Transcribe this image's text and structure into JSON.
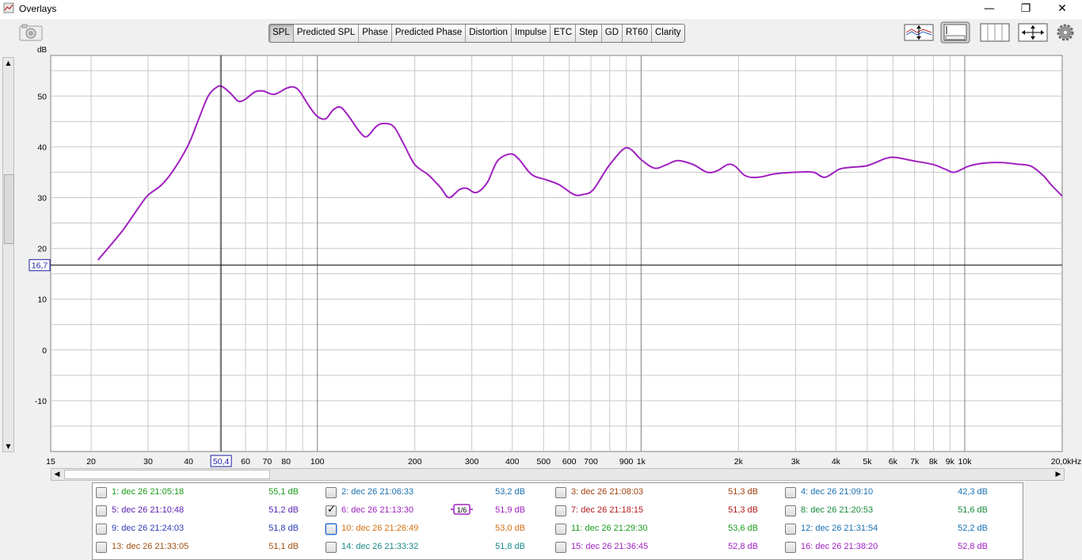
{
  "window": {
    "title": "Overlays",
    "controls": [
      "—",
      "❐",
      "✕"
    ]
  },
  "tabs": [
    {
      "label": "SPL",
      "active": true
    },
    {
      "label": "Predicted SPL",
      "active": false
    },
    {
      "label": "Phase",
      "active": false
    },
    {
      "label": "Predicted Phase",
      "active": false
    },
    {
      "label": "Distortion",
      "active": false
    },
    {
      "label": "Impulse",
      "active": false
    },
    {
      "label": "ETC",
      "active": false
    },
    {
      "label": "Step",
      "active": false
    },
    {
      "label": "GD",
      "active": false
    },
    {
      "label": "RT60",
      "active": false
    },
    {
      "label": "Clarity",
      "active": false
    }
  ],
  "colors": {
    "trace": "#a020c0",
    "cursor_box": "#1a1aa0",
    "grid": "#c8c8c8",
    "grid_major": "#808080"
  },
  "chart_data": {
    "type": "line",
    "ylabel": "dB",
    "xlim": [
      15,
      20000
    ],
    "ylim": [
      -20,
      58
    ],
    "x_scale": "log",
    "y_ticks": [
      -10,
      0,
      10,
      20,
      30,
      40,
      50
    ],
    "x_ticks": [
      {
        "v": 15,
        "label": "15"
      },
      {
        "v": 20,
        "label": "20"
      },
      {
        "v": 30,
        "label": "30"
      },
      {
        "v": 40,
        "label": "40"
      },
      {
        "v": 60,
        "label": "60"
      },
      {
        "v": 70,
        "label": "70"
      },
      {
        "v": 80,
        "label": "80"
      },
      {
        "v": 100,
        "label": "100"
      },
      {
        "v": 200,
        "label": "200"
      },
      {
        "v": 300,
        "label": "300"
      },
      {
        "v": 400,
        "label": "400"
      },
      {
        "v": 500,
        "label": "500"
      },
      {
        "v": 600,
        "label": "600"
      },
      {
        "v": 700,
        "label": "700"
      },
      {
        "v": 900,
        "label": "900"
      },
      {
        "v": 1000,
        "label": "1k"
      },
      {
        "v": 2000,
        "label": "2k"
      },
      {
        "v": 3000,
        "label": "3k"
      },
      {
        "v": 4000,
        "label": "4k"
      },
      {
        "v": 5000,
        "label": "5k"
      },
      {
        "v": 6000,
        "label": "6k"
      },
      {
        "v": 7000,
        "label": "7k"
      },
      {
        "v": 8000,
        "label": "8k"
      },
      {
        "v": 9000,
        "label": "9k"
      },
      {
        "v": 10000,
        "label": "10k"
      },
      {
        "v": 20000,
        "label": "20,0kHz"
      }
    ],
    "cursor": {
      "x": 50.4,
      "x_label": "50,4",
      "y": 16.7,
      "y_label": "16,7"
    },
    "series": [
      {
        "color": "#a020c0",
        "points": [
          [
            21,
            17.7
          ],
          [
            25,
            23.5
          ],
          [
            28,
            28
          ],
          [
            30,
            30.5
          ],
          [
            33,
            32.5
          ],
          [
            36,
            35.5
          ],
          [
            40,
            40.5
          ],
          [
            43,
            45.5
          ],
          [
            46,
            50
          ],
          [
            49,
            51.8
          ],
          [
            51,
            51.8
          ],
          [
            54,
            50.5
          ],
          [
            57,
            49
          ],
          [
            60,
            49.4
          ],
          [
            64,
            50.8
          ],
          [
            68,
            51
          ],
          [
            72,
            50.4
          ],
          [
            75,
            50.5
          ],
          [
            80,
            51.5
          ],
          [
            84,
            51.8
          ],
          [
            88,
            51
          ],
          [
            95,
            47.7
          ],
          [
            100,
            46
          ],
          [
            106,
            45.5
          ],
          [
            112,
            47.3
          ],
          [
            118,
            47.8
          ],
          [
            125,
            46
          ],
          [
            135,
            43
          ],
          [
            142,
            42
          ],
          [
            152,
            44
          ],
          [
            160,
            44.6
          ],
          [
            172,
            44
          ],
          [
            185,
            40.5
          ],
          [
            200,
            36.5
          ],
          [
            220,
            34.5
          ],
          [
            240,
            32
          ],
          [
            255,
            30
          ],
          [
            275,
            31.6
          ],
          [
            290,
            31.8
          ],
          [
            310,
            31
          ],
          [
            335,
            33
          ],
          [
            360,
            37.2
          ],
          [
            395,
            38.6
          ],
          [
            420,
            37.5
          ],
          [
            460,
            34.5
          ],
          [
            510,
            33.5
          ],
          [
            560,
            32.5
          ],
          [
            620,
            30.6
          ],
          [
            660,
            30.6
          ],
          [
            710,
            31.5
          ],
          [
            790,
            36
          ],
          [
            880,
            39.5
          ],
          [
            930,
            39.5
          ],
          [
            1000,
            37.5
          ],
          [
            1100,
            35.8
          ],
          [
            1200,
            36.5
          ],
          [
            1300,
            37.3
          ],
          [
            1450,
            36.5
          ],
          [
            1600,
            35
          ],
          [
            1720,
            35.3
          ],
          [
            1850,
            36.5
          ],
          [
            1950,
            36.2
          ],
          [
            2100,
            34.3
          ],
          [
            2300,
            34
          ],
          [
            2600,
            34.7
          ],
          [
            3000,
            35
          ],
          [
            3400,
            35
          ],
          [
            3700,
            34
          ],
          [
            4100,
            35.6
          ],
          [
            4500,
            36
          ],
          [
            5000,
            36.3
          ],
          [
            5700,
            37.7
          ],
          [
            6100,
            37.9
          ],
          [
            7000,
            37.2
          ],
          [
            8000,
            36.5
          ],
          [
            8700,
            35.6
          ],
          [
            9300,
            35
          ],
          [
            10300,
            36.2
          ],
          [
            11500,
            36.8
          ],
          [
            13000,
            36.9
          ],
          [
            14500,
            36.6
          ],
          [
            16000,
            36.2
          ],
          [
            17500,
            34.3
          ],
          [
            18500,
            32.5
          ],
          [
            20000,
            30.3
          ]
        ]
      }
    ]
  },
  "measurements": [
    {
      "label": "1: dec 26 21:05:18",
      "value": "55,1 dB",
      "color": "#1a9a1a",
      "checked": false
    },
    {
      "label": "2: dec 26 21:06:33",
      "value": "53,2 dB",
      "color": "#1a70b0",
      "checked": false
    },
    {
      "label": "3: dec 26 21:08:03",
      "value": "51,3 dB",
      "color": "#a04010",
      "checked": false
    },
    {
      "label": "4: dec 26 21:09:10",
      "value": "42,3 dB",
      "color": "#1a70b0",
      "checked": false
    },
    {
      "label": "5: dec 26 21:10:48",
      "value": "51,2 dB",
      "color": "#5a20b0",
      "checked": false
    },
    {
      "label": "6: dec 26 21:13:30",
      "value": "51,9 dB",
      "color": "#a020c0",
      "checked": true
    },
    {
      "label": "7: dec 26 21:18:15",
      "value": "51,3 dB",
      "color": "#b01a1a",
      "checked": false
    },
    {
      "label": "8: dec 26 21:20:53",
      "value": "51,6 dB",
      "color": "#1a8a3a",
      "checked": false
    },
    {
      "label": "9: dec 26 21:24:03",
      "value": "51,8 dB",
      "color": "#2a3ab0",
      "checked": false
    },
    {
      "label": "10: dec 26 21:26:49",
      "value": "53,0 dB",
      "color": "#d07010",
      "checked": false,
      "focus": true
    },
    {
      "label": "11: dec 26 21:29:30",
      "value": "53,6 dB",
      "color": "#1a9a1a",
      "checked": false
    },
    {
      "label": "12: dec 26 21:31:54",
      "value": "52,2 dB",
      "color": "#1a70b0",
      "checked": false
    },
    {
      "label": "13: dec 26 21:33:05",
      "value": "51,1 dB",
      "color": "#a05010",
      "checked": false
    },
    {
      "label": "14: dec 26 21:33:32",
      "value": "51,8 dB",
      "color": "#1a8a8a",
      "checked": false
    },
    {
      "label": "15: dec 26 21:36:45",
      "value": "52,8 dB",
      "color": "#a020c0",
      "checked": false
    },
    {
      "label": "16: dec 26 21:38:20",
      "value": "52,8 dB",
      "color": "#a020c0",
      "checked": false
    }
  ],
  "smoothing_badge": "1/6"
}
